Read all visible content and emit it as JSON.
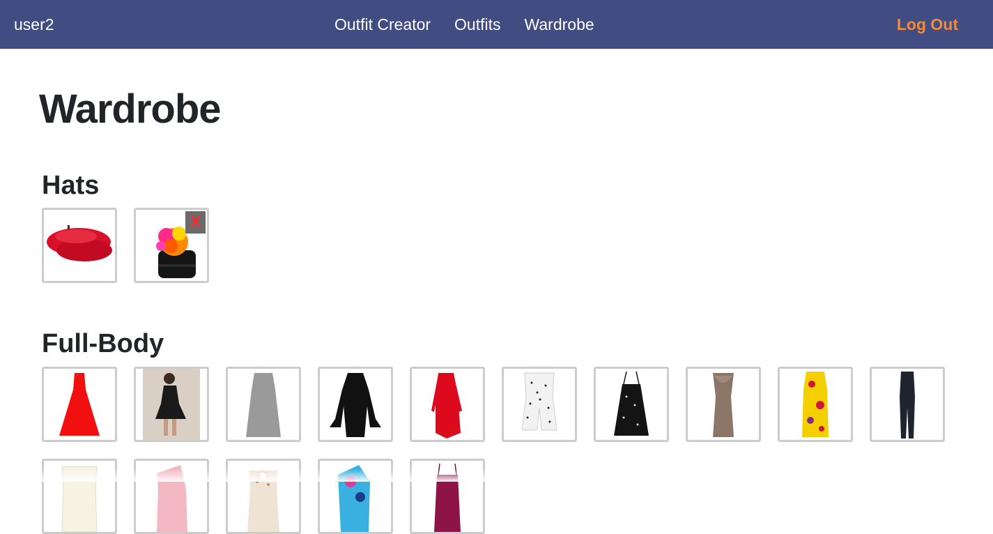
{
  "nav": {
    "user": "user2",
    "links": [
      "Outfit Creator",
      "Outfits",
      "Wardrobe"
    ],
    "logout": "Log Out"
  },
  "page": {
    "title": "Wardrobe"
  },
  "sections": [
    {
      "title": "Hats",
      "items": [
        {
          "name": "red-beret",
          "delete_label": ""
        },
        {
          "name": "black-pompom-beanie",
          "delete_label": "X"
        }
      ]
    },
    {
      "title": "Full-Body",
      "items": [
        {
          "name": "red-halter-dress"
        },
        {
          "name": "black-skater-dress-model"
        },
        {
          "name": "grey-tank-dress"
        },
        {
          "name": "black-bell-sleeve-dress"
        },
        {
          "name": "red-long-sleeve-dress"
        },
        {
          "name": "white-polka-dot-romper"
        },
        {
          "name": "black-sequin-slip-dress"
        },
        {
          "name": "taupe-cowl-dress"
        },
        {
          "name": "yellow-floral-dress"
        },
        {
          "name": "navy-jumpsuit"
        },
        {
          "name": "cream-top-dress"
        },
        {
          "name": "pink-one-shoulder-dress"
        },
        {
          "name": "floral-collar-dress"
        },
        {
          "name": "blue-print-swimsuit"
        },
        {
          "name": "burgundy-slip-dress"
        }
      ]
    }
  ],
  "colors": {
    "navbar": "#404c82",
    "logout": "#f58a34",
    "tile_border": "#cccccc",
    "delete_bg": "#6b6b6b",
    "delete_x": "#ff2a2a"
  }
}
